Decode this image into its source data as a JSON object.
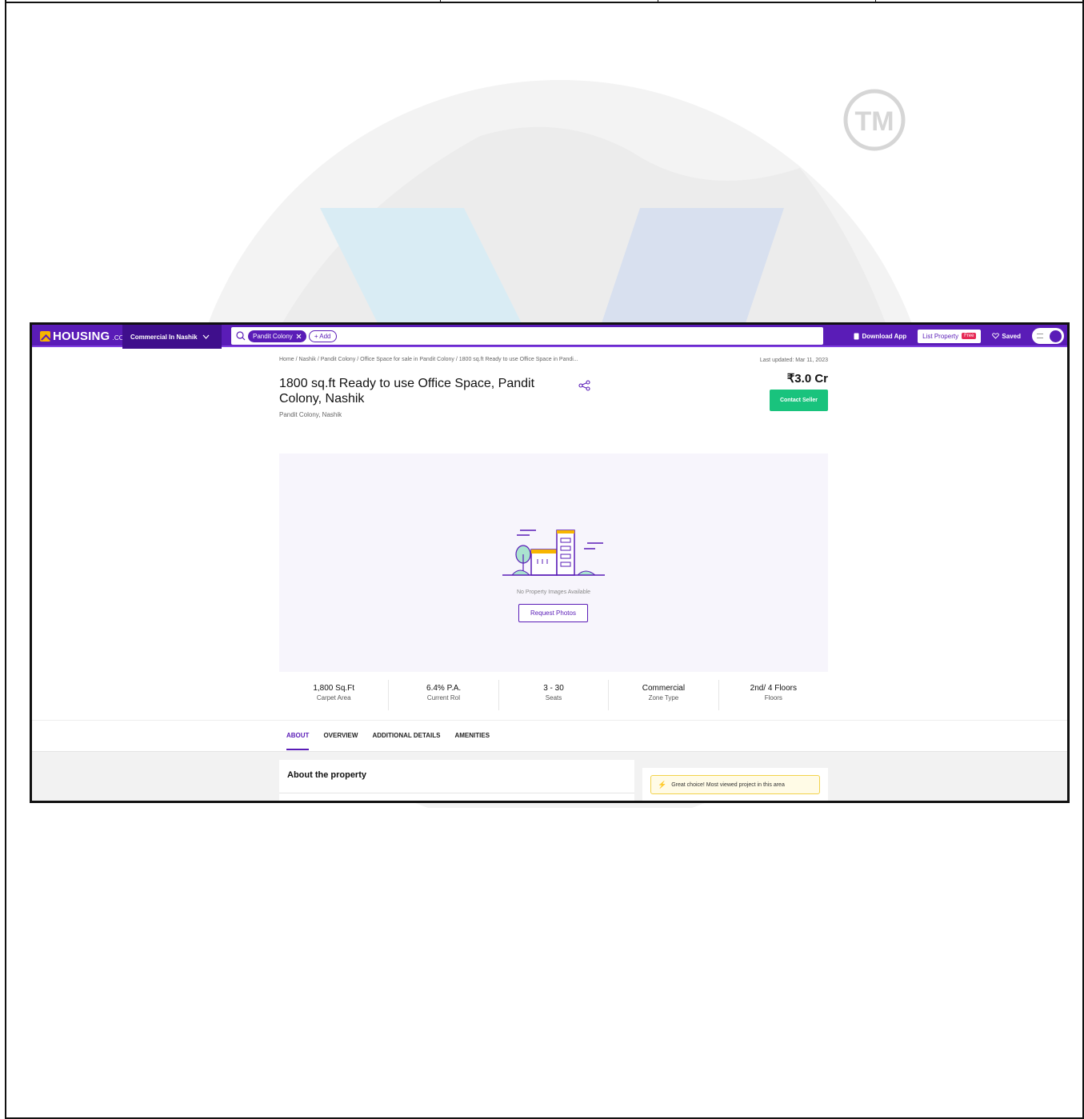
{
  "watermark": {
    "trademark": "TM"
  },
  "nav": {
    "logo_text": "HOUSING",
    "logo_suffix": ".COM",
    "city_dropdown": "Commercial In Nashik",
    "search_chip": "Pandit Colony",
    "add_chip": "+ Add",
    "download_app": "Download App",
    "list_property": "List Property",
    "free_badge": "Free",
    "saved": "Saved"
  },
  "page": {
    "breadcrumb": "Home / Nashik / Pandit Colony / Office Space for sale in Pandit Colony / 1800 sq.ft Ready to use Office Space in Pandi...",
    "last_updated": "Last updated: Mar 11, 2023",
    "title": "1800 sq.ft Ready to use Office Space, Pandit Colony, Nashik",
    "locality": "Pandit Colony, Nashik",
    "price": "₹3.0 Cr",
    "contact_seller": "Contact Seller"
  },
  "gallery": {
    "no_images_text": "No Property Images Available",
    "request_photos": "Request Photos"
  },
  "stats": [
    {
      "value": "1,800 Sq.Ft",
      "label": "Carpet Area"
    },
    {
      "value": "6.4% P.A.",
      "label": "Current RoI"
    },
    {
      "value": "3 - 30",
      "label": "Seats"
    },
    {
      "value": "Commercial",
      "label": "Zone Type"
    },
    {
      "value": "2nd/ 4 Floors",
      "label": "Floors"
    }
  ],
  "tabs": [
    "ABOUT",
    "OVERVIEW",
    "ADDITIONAL DETAILS",
    "AMENITIES"
  ],
  "about": {
    "title": "About the property"
  },
  "highlight": {
    "text": "Great choice! Most viewed project in this area"
  },
  "colors": {
    "brand": "#5a1cb7",
    "contact_button": "#19c37d",
    "free_badge": "#e62a55"
  }
}
